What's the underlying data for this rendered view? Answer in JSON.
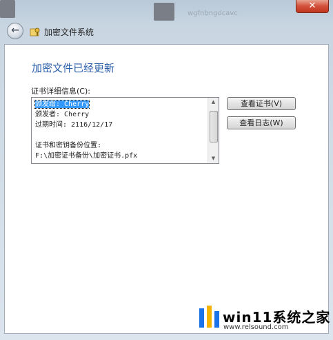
{
  "window": {
    "close_glyph": "✕",
    "title": "加密文件系统"
  },
  "background": {
    "item_text": "wgfnbngdcavc"
  },
  "page": {
    "heading": "加密文件已经更新",
    "details_label": "证书详细信息(C):",
    "details_lines": [
      "颁发给: Cherry",
      "颁发者: Cherry",
      "过期时间: 2116/12/17",
      "",
      "证书和密钥备份位置:",
      "F:\\加密证书备份\\加密证书.pfx"
    ],
    "selected_line": 0,
    "buttons": {
      "view_cert": "查看证书(V)",
      "view_log": "查看日志(W)"
    }
  },
  "watermark": {
    "title": "win11系统之家",
    "url": "www.relsound.com"
  },
  "colors": {
    "heading": "#2a5ca8",
    "selection": "#3399ff",
    "logo_blue": "#1a73e8",
    "logo_yellow": "#f5b400"
  }
}
